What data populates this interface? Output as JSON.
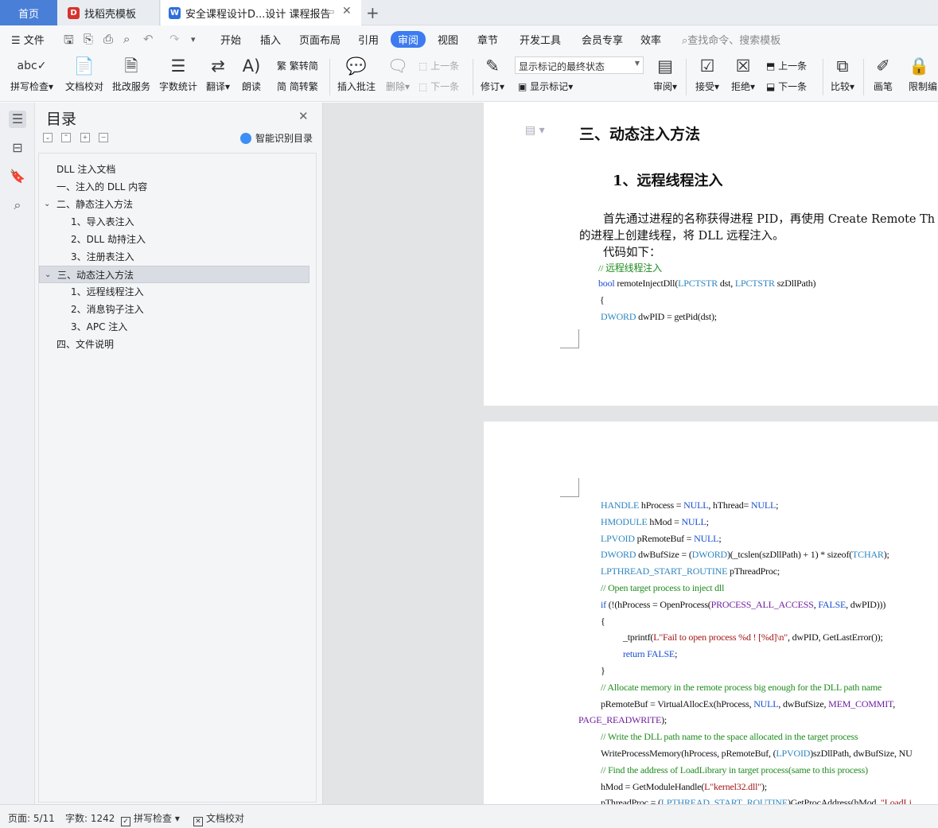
{
  "tabs": {
    "home": "首页",
    "template": "找稻壳模板",
    "document": "安全课程设计D...设计 课程报告"
  },
  "menu": {
    "file": "文件",
    "items": [
      "开始",
      "插入",
      "页面布局",
      "引用",
      "审阅",
      "视图",
      "章节",
      "开发工具",
      "会员专享",
      "效率"
    ],
    "active": "审阅",
    "search": "查找命令、搜索模板"
  },
  "ribbon": {
    "spellcheck": "拼写检查",
    "doccheck": "文档校对",
    "review_service": "批改服务",
    "wordcount": "字数统计",
    "translate": "翻译",
    "read": "朗读",
    "trad_to_simp": "繁转简",
    "simp_to_trad": "简转繁",
    "insert_comment": "插入批注",
    "delete": "删除",
    "prev": "上一条",
    "next": "下一条",
    "track": "修订",
    "markup_state": "显示标记的最终状态",
    "show_markup": "显示标记",
    "review": "审阅",
    "accept": "接受",
    "reject": "拒绝",
    "prev2": "上一条",
    "next2": "下一条",
    "compare": "比较",
    "pen": "画笔",
    "restrict": "限制编"
  },
  "nav": {
    "title": "目录",
    "smart_toc": "智能识别目录",
    "toc": [
      {
        "text": "DLL 注入文档",
        "level": 0,
        "arrow": ""
      },
      {
        "text": "一、注入的 DLL 内容",
        "level": 0,
        "arrow": ""
      },
      {
        "text": "二、静态注入方法",
        "level": 0,
        "arrow": "v"
      },
      {
        "text": "1、导入表注入",
        "level": 1,
        "arrow": ""
      },
      {
        "text": "2、DLL  劫持注入",
        "level": 1,
        "arrow": ""
      },
      {
        "text": "3、注册表注入",
        "level": 1,
        "arrow": ""
      },
      {
        "text": "三、动态注入方法",
        "level": 0,
        "arrow": "v",
        "selected": true
      },
      {
        "text": "1、远程线程注入",
        "level": 1,
        "arrow": ""
      },
      {
        "text": "2、消息钩子注入",
        "level": 1,
        "arrow": ""
      },
      {
        "text": "3、APC 注入",
        "level": 1,
        "arrow": ""
      },
      {
        "text": "四、文件说明",
        "level": 0,
        "arrow": ""
      }
    ]
  },
  "doc": {
    "heading": "三、动态注入方法",
    "subheading": "1、远程线程注入",
    "para1": "首先通过进程的名称获得进程 PID，再使用 Create Remote Th",
    "para2": "的进程上创建线程，将 DLL 远程注入。",
    "para3": "代码如下：",
    "page1_code": [
      "// 远程线程注入",
      "bool remoteInjectDll(LPCTSTR dst, LPCTSTR   szDllPath)",
      "{",
      "DWORD dwPID = getPid(dst);"
    ],
    "page2_code": [
      "HANDLE hProcess = NULL, hThread= NULL;",
      "HMODULE hMod = NULL;",
      "LPVOID pRemoteBuf = NULL;",
      "DWORD dwBufSize = (DWORD)(_tcslen(szDllPath) + 1) * sizeof(TCHAR);",
      "LPTHREAD_START_ROUTINE pThreadProc;",
      "// Open target process to inject dll",
      "if (!(hProcess = OpenProcess(PROCESS_ALL_ACCESS, FALSE, dwPID)))",
      "{",
      "_tprintf(L\"Fail to open process %d ! [%d]\\n\", dwPID, GetLastError());",
      "return FALSE;",
      "}",
      "// Allocate memory in the remote process big enough for the DLL path name",
      "pRemoteBuf = VirtualAllocEx(hProcess, NULL, dwBufSize, MEM_COMMIT,",
      "PAGE_READWRITE);",
      "// Write the DLL path name to the space allocated in the target process",
      "WriteProcessMemory(hProcess, pRemoteBuf, (LPVOID)szDllPath, dwBufSize, NU",
      "// Find the address of LoadLibrary in target process(same to this process)",
      "hMod = GetModuleHandle(L\"kernel32.dll\");",
      "pThreadProc = (LPTHREAD_START_ROUTINE)GetProcAddress(hMod, \"LoadLi"
    ]
  },
  "status": {
    "page": "页面: 5/11",
    "words": "字数: 1242",
    "spell": "拼写检查",
    "doccheck": "文档校对"
  },
  "colors": {
    "home_tab": "#4a7fd8",
    "active_menu": "#3d7bf0",
    "code_keyword": "#1a4fd0",
    "code_comment": "#1f8a1f",
    "code_string": "#a31515"
  }
}
